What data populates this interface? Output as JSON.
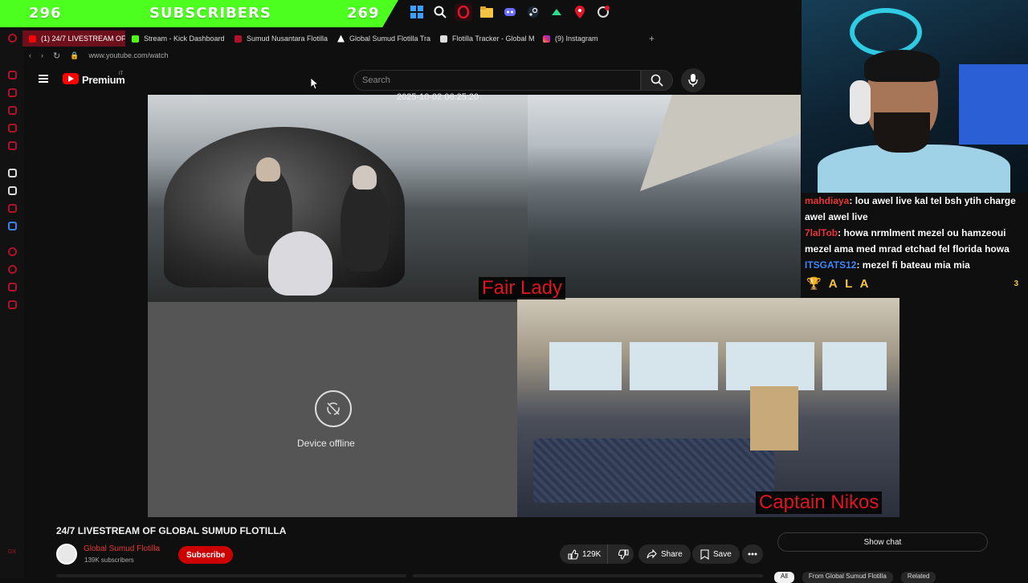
{
  "stream_overlay": {
    "sub_count_left": "296",
    "sub_label": "SUBSCRIBERS",
    "sub_count_right": "269"
  },
  "taskbar_icons": [
    "windows-start-icon",
    "search-icon",
    "opera-browser-icon",
    "file-explorer-icon",
    "discord-icon",
    "steam-icon",
    "app-icon",
    "location-pin-icon",
    "notification-icon"
  ],
  "browser": {
    "tabs": [
      {
        "label": "(1) 24/7 LIVESTREAM OF",
        "active": true
      },
      {
        "label": "Stream - Kick Dashboard",
        "active": false
      },
      {
        "label": "Sumud Nusantara Flotilla",
        "active": false
      },
      {
        "label": "Global Sumud Flotilla Tra",
        "active": false
      },
      {
        "label": "Flotilla Tracker - Global M",
        "active": false
      },
      {
        "label": "(9) Instagram",
        "active": false
      }
    ],
    "new_tab": "+",
    "url": "www.youtube.com/watch"
  },
  "youtube": {
    "logo_label": "Premium",
    "country": "IT",
    "search_placeholder": "Search"
  },
  "video": {
    "timestamp": "2025-10-02 06:25:20",
    "label_cam_1": "Fair Lady",
    "label_cam_4": "Captain Nikos",
    "offline_text": "Device offline"
  },
  "chat": {
    "messages": [
      {
        "user": "mahdiaya",
        "text": ": lou awel live kal tel bsh ytih charge awel awel live"
      },
      {
        "user": "7lalTob",
        "text": ": howa nrmlment mezel ou hamzeoui mezel ama med mrad etchad fel florida howa"
      },
      {
        "user": "ITSGATS12",
        "text": ": mezel fi bateau mia mia"
      }
    ],
    "alert_text": "A L A",
    "alert_count": "3"
  },
  "details": {
    "title": "24/7 LIVESTREAM OF GLOBAL SUMUD FLOTILLA",
    "channel_name": "Global Sumud Flotilla",
    "subscribers": "139K subscribers",
    "subscribe_label": "Subscribe",
    "likes": "129K",
    "share_label": "Share",
    "save_label": "Save",
    "show_chat_label": "Show chat",
    "chips": [
      "All",
      "From Global Sumud Flotilla",
      "Related"
    ]
  },
  "colors": {
    "sub_bar": "#4cff1e",
    "yt_red": "#ff0000",
    "boat_label": "#e0161c",
    "accent_opera": "#b0122a"
  }
}
